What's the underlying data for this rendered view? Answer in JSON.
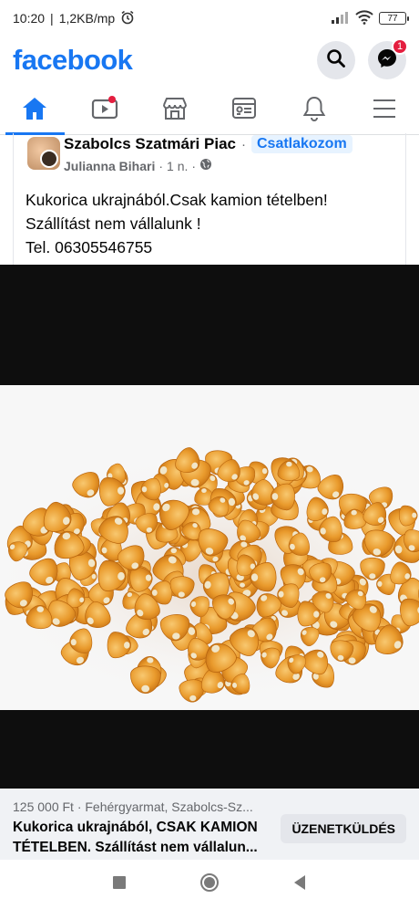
{
  "status_bar": {
    "time": "10:20",
    "speed": "1,2KB/mp",
    "battery": "77"
  },
  "header": {
    "logo": "facebook",
    "messenger_badge": "1"
  },
  "tabs": [
    {
      "icon": "home-icon",
      "active": true
    },
    {
      "icon": "watch-icon",
      "has_dot": true
    },
    {
      "icon": "marketplace-icon"
    },
    {
      "icon": "news-icon"
    },
    {
      "icon": "bell-icon"
    },
    {
      "icon": "menu-icon"
    }
  ],
  "post": {
    "group": "Szabolcs Szatmári Piac",
    "separator": "·",
    "join_label": "Csatlakozom",
    "author": "Julianna Bihari",
    "time": "1 n.",
    "dot": "·",
    "text_lines": [
      "Kukorica ukrajnából.Csak kamion tételben!",
      "Szállítást nem vállalunk !",
      "Tel. 06305546755"
    ]
  },
  "market": {
    "price_location": "125 000 Ft · Fehérgyarmat, Szabolcs-Sz...",
    "title_line1": "Kukorica ukrajnából, CSAK KAMION",
    "title_line2": "TÉTELBEN. Szállítást nem vállalun...",
    "message_button": "ÜZENETKÜLDÉS"
  },
  "colors": {
    "brand": "#1877f2",
    "badge": "#e41e3f"
  }
}
